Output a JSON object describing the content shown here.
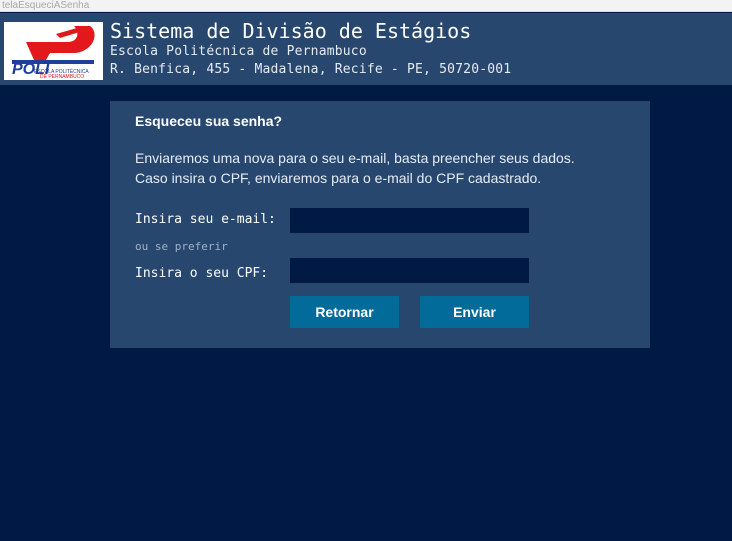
{
  "window": {
    "title": "telaEsqueciASenha"
  },
  "header": {
    "title": "Sistema de Divisão de Estágios",
    "school": "Escola Politécnica de Pernambuco",
    "address": "R. Benfica, 455 - Madalena, Recife - PE, 50720-001",
    "logo": {
      "brand": "POLI",
      "caption_line1": "ESCOLA POLITÉCNICA",
      "caption_line2": "DE PERNAMBUCO",
      "colors": {
        "red": "#e3181d",
        "blue": "#1f3d9c"
      }
    }
  },
  "form": {
    "title": "Esqueceu sua senha?",
    "description_line1": "Enviaremos uma nova para o seu e-mail, basta preencher seus dados.",
    "description_line2": "Caso insira o CPF, enviaremos para o e-mail do CPF cadastrado.",
    "email_label": "Insira seu e-mail:",
    "email_value": "",
    "or_hint": "ou se preferir",
    "cpf_label": "Insira o seu CPF:",
    "cpf_value": "",
    "back_button": "Retornar",
    "send_button": "Enviar"
  },
  "colors": {
    "background": "#001a45",
    "header": "#27476e",
    "panel": "#27476e",
    "input": "#001a45",
    "button": "#036b9a"
  }
}
